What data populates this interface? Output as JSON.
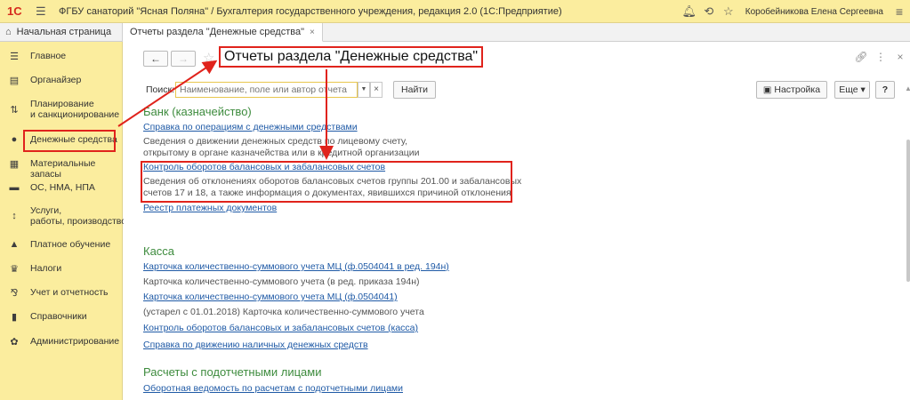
{
  "titlebar": {
    "logo": "1С",
    "title": "ФГБУ санаторий \"Ясная Поляна\" / Бухгалтерия государственного учреждения, редакция 2.0  (1С:Предприятие)",
    "user": "Коробейникова Елена Сергеевна",
    "icons": [
      "bell-icon",
      "history-icon",
      "star-icon",
      "menu-icon"
    ]
  },
  "tabs": {
    "home": "Начальная страница",
    "active": "Отчеты раздела \"Денежные средства\""
  },
  "sidebar": {
    "items": [
      {
        "label": "Главное",
        "icon": "hamburger-icon"
      },
      {
        "label": "Органайзер",
        "icon": "organizer-icon"
      },
      {
        "label": "Планирование\nи санкционирование",
        "icon": "planning-icon"
      },
      {
        "label": "Денежные средства",
        "icon": "money-icon"
      },
      {
        "label": "Материальные запасы",
        "icon": "stock-icon"
      },
      {
        "label": "ОС, НМА, НПА",
        "icon": "truck-icon"
      },
      {
        "label": "Услуги,\nработы, производство",
        "icon": "services-icon"
      },
      {
        "label": "Платное обучение",
        "icon": "education-icon"
      },
      {
        "label": "Налоги",
        "icon": "taxes-icon"
      },
      {
        "label": "Учет и отчетность",
        "icon": "accounting-icon"
      },
      {
        "label": "Справочники",
        "icon": "books-icon"
      },
      {
        "label": "Администрирование",
        "icon": "admin-gear-icon"
      }
    ]
  },
  "main": {
    "title": "Отчеты раздела \"Денежные средства\"",
    "search_label": "Поиск:",
    "search_placeholder": "Наименование, поле или автор отчета",
    "find_button": "Найти",
    "settings_button": "Настройка",
    "more_button": "Еще",
    "help_button": "?",
    "sections": [
      {
        "title": "Банк (казначейство)",
        "links": [
          {
            "label": "Справка по операциям с денежными средствами"
          },
          {
            "label": "Контроль оборотов балансовых и забалансовых счетов"
          },
          {
            "label": "Реестр платежных документов"
          }
        ],
        "descs": [
          "Сведения о движении денежных средств по лицевому счету,",
          "открытому в органе казначейства или в кредитной организации",
          "Сведения об отклонениях оборотов балансовых счетов группы 201.00 и забалансовых",
          "счетов 17 и 18, а также информация о документах, явившихся причиной отклонения"
        ]
      },
      {
        "title": "Касса",
        "links": [
          {
            "label": "Карточка количественно-суммового учета МЦ  (ф.0504041 в ред. 194н)"
          },
          {
            "label": "Карточка количественно-суммового учета МЦ  (ф.0504041)"
          },
          {
            "label": "Контроль оборотов балансовых и забалансовых счетов (касса)"
          },
          {
            "label": "Справка по движению наличных денежных средств"
          }
        ],
        "descs": [
          "Карточка количественно-суммового учета (в ред. приказа 194н)",
          "(устарел с 01.01.2018) Карточка количественно-суммового учета"
        ]
      },
      {
        "title": "Расчеты с подотчетными лицами",
        "links": [
          {
            "label": "Оборотная ведомость по расчетам с подотчетными лицами"
          }
        ]
      }
    ]
  },
  "colors": {
    "accent_yellow": "#fbed9e",
    "annotation_red": "#e0231c",
    "section_green": "#3d8b3d",
    "link_blue": "#1f5aa6"
  }
}
